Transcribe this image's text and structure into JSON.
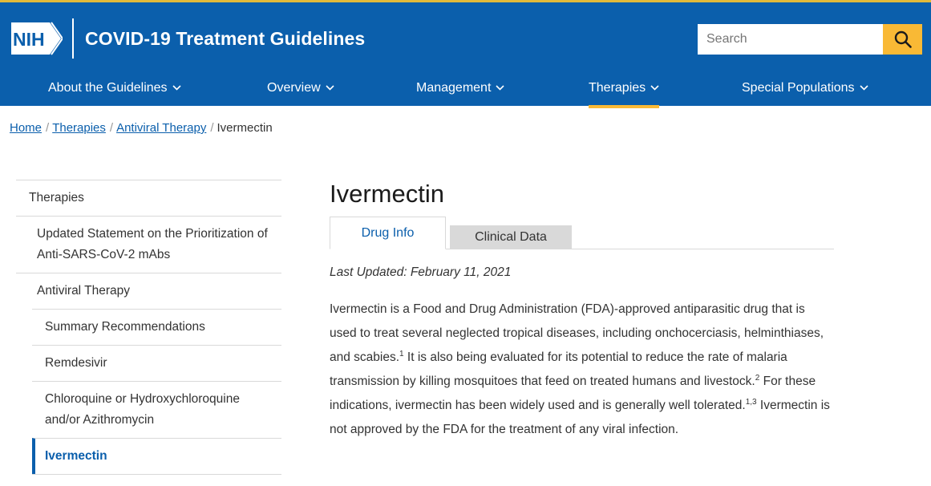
{
  "header": {
    "logo_text": "NIH",
    "site_title": "COVID-19 Treatment Guidelines",
    "search_placeholder": "Search",
    "colors": {
      "brand_blue": "#0b5fac",
      "accent_gold": "#f9b935"
    }
  },
  "nav": {
    "items": [
      {
        "label": "About the Guidelines",
        "active": false
      },
      {
        "label": "Overview",
        "active": false
      },
      {
        "label": "Management",
        "active": false
      },
      {
        "label": "Therapies",
        "active": true
      },
      {
        "label": "Special Populations",
        "active": false
      }
    ]
  },
  "breadcrumb": {
    "items": [
      "Home",
      "Therapies",
      "Antiviral Therapy"
    ],
    "current": "Ivermectin"
  },
  "sidebar": {
    "items": [
      {
        "label": "Therapies",
        "level": 0
      },
      {
        "label": "Updated Statement on the Prioritization of Anti-SARS-CoV-2 mAbs",
        "level": 1
      },
      {
        "label": "Antiviral Therapy",
        "level": 1
      },
      {
        "label": "Summary Recommendations",
        "level": 2
      },
      {
        "label": "Remdesivir",
        "level": 2
      },
      {
        "label": "Chloroquine or Hydroxychloroquine and/or Azithromycin",
        "level": 2
      },
      {
        "label": "Ivermectin",
        "level": 2,
        "active": true
      }
    ]
  },
  "main": {
    "title": "Ivermectin",
    "tabs": [
      {
        "label": "Drug Info",
        "active": true
      },
      {
        "label": "Clinical Data",
        "active": false
      }
    ],
    "last_updated": "Last Updated: February 11, 2021",
    "paragraph": {
      "part1": "Ivermectin is a Food and Drug Administration (FDA)-approved antiparasitic drug that is used to treat several neglected tropical diseases, including onchocerciasis, helminthiases, and scabies.",
      "ref1": "1",
      "part2": " It is also being evaluated for its potential to reduce the rate of malaria transmission by killing mosquitoes that feed on treated humans and livestock.",
      "ref2": "2",
      "part3": " For these indications, ivermectin has been widely used and is generally well tolerated.",
      "ref3": "1,3",
      "part4": " Ivermectin is not approved by the FDA for the treatment of any viral infection."
    }
  }
}
